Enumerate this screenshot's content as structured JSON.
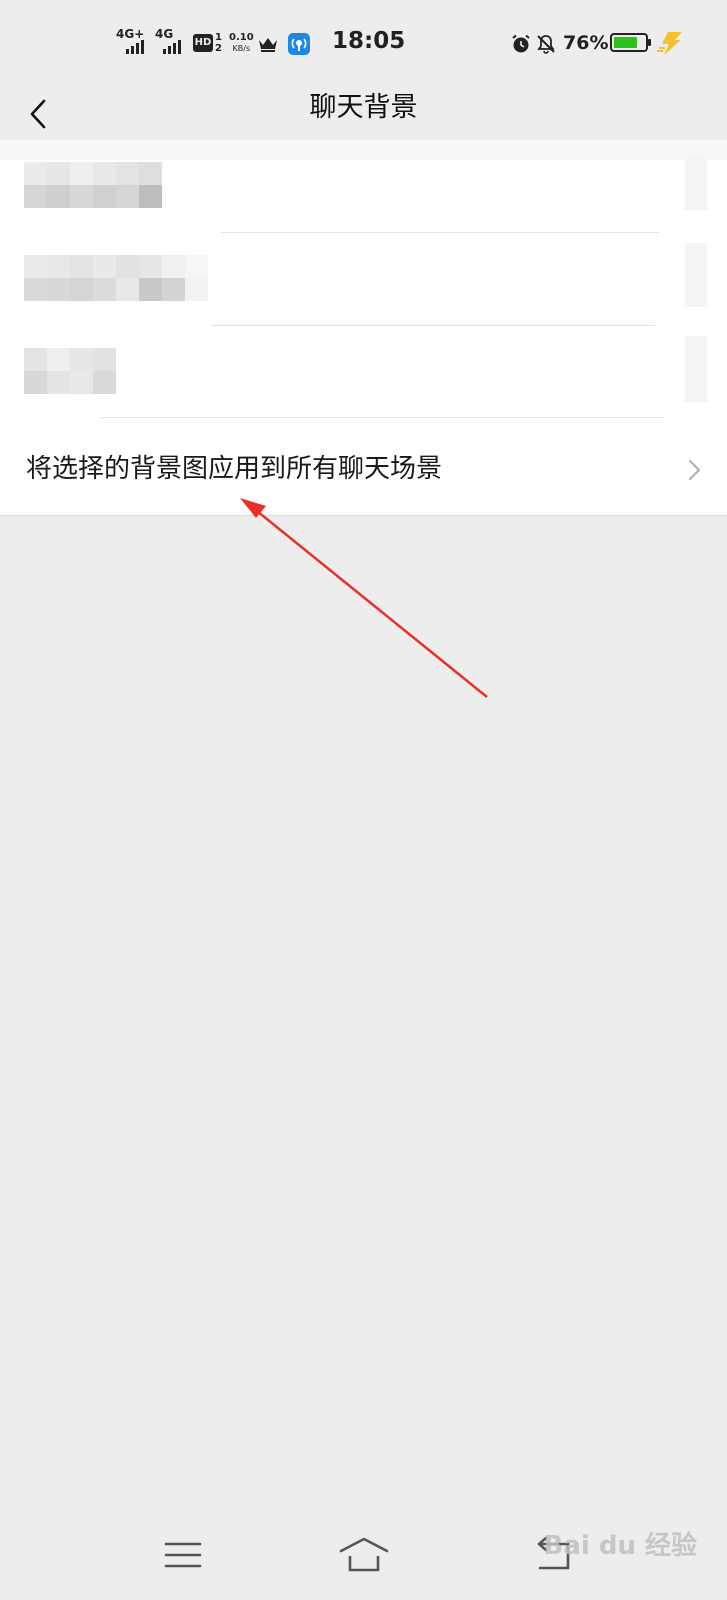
{
  "status_bar": {
    "sim1_label": "4G+",
    "sim2_label": "4G",
    "hd_label": "HD",
    "hd_sim_top": "1",
    "hd_sim_bottom": "2",
    "net_speed_value": "0.10",
    "net_speed_unit": "KB/s",
    "time": "18:05",
    "battery_percent": "76%",
    "battery_level": 0.76,
    "icons": [
      "crown-icon",
      "app-notification-icon",
      "alarm-icon",
      "mute-icon",
      "battery-icon",
      "charging-icon"
    ]
  },
  "header": {
    "title": "聊天背景",
    "back_icon": "chevron-left-icon"
  },
  "settings": {
    "apply_all_label": "将选择的背景图应用到所有聊天场景",
    "chevron_icon": "chevron-right-icon"
  },
  "system_nav": {
    "icons": [
      "menu-icon",
      "home-icon",
      "back-icon"
    ]
  },
  "watermark": {
    "text": "Bai du 经验"
  },
  "colors": {
    "page_background": "#ededed",
    "list_background": "#ffffff",
    "annotation_arrow": "#e8302a",
    "battery_fill": "#2ec11e",
    "charge_bolt": "#f2c230"
  }
}
